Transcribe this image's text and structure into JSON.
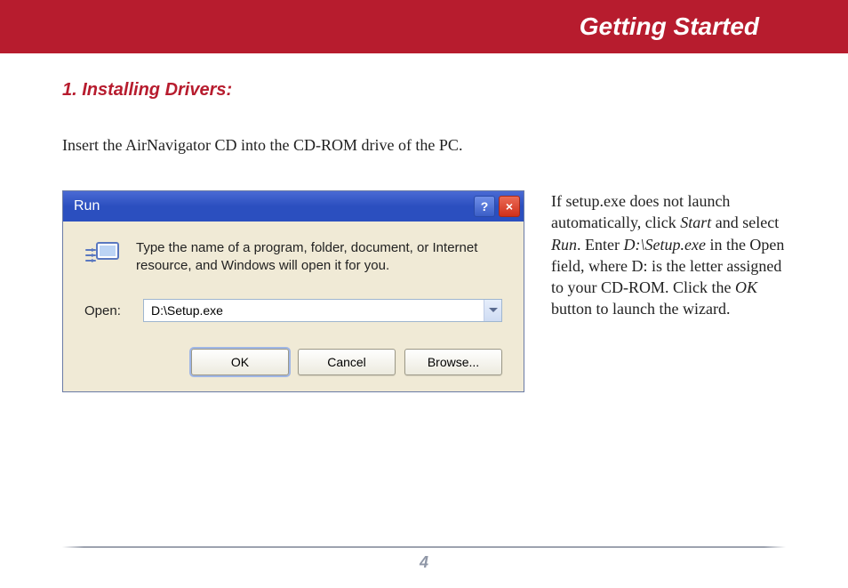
{
  "header": {
    "title": "Getting Started"
  },
  "section": {
    "heading": "1. Installing Drivers:",
    "intro": "Insert the AirNavigator CD into the CD-ROM drive of the PC."
  },
  "side_paragraph": {
    "t1": "If setup.exe does not launch automatically, click ",
    "i1": "Start",
    "t2": " and select ",
    "i2": "Run",
    "t3": ".  Enter ",
    "i3": "D:\\Setup.exe",
    "t4": " in the Open field, where D: is the letter assigned to your CD-ROM.  Click the ",
    "i4": "OK",
    "t5": " button to launch the wizard."
  },
  "run_dialog": {
    "title": "Run",
    "help_symbol": "?",
    "close_symbol": "×",
    "description": "Type the name of a program, folder, document, or Internet resource, and Windows will open it for you.",
    "open_label": "Open:",
    "open_value": "D:\\Setup.exe",
    "buttons": {
      "ok": "OK",
      "cancel": "Cancel",
      "browse": "Browse..."
    }
  },
  "footer": {
    "page_number": "4"
  }
}
